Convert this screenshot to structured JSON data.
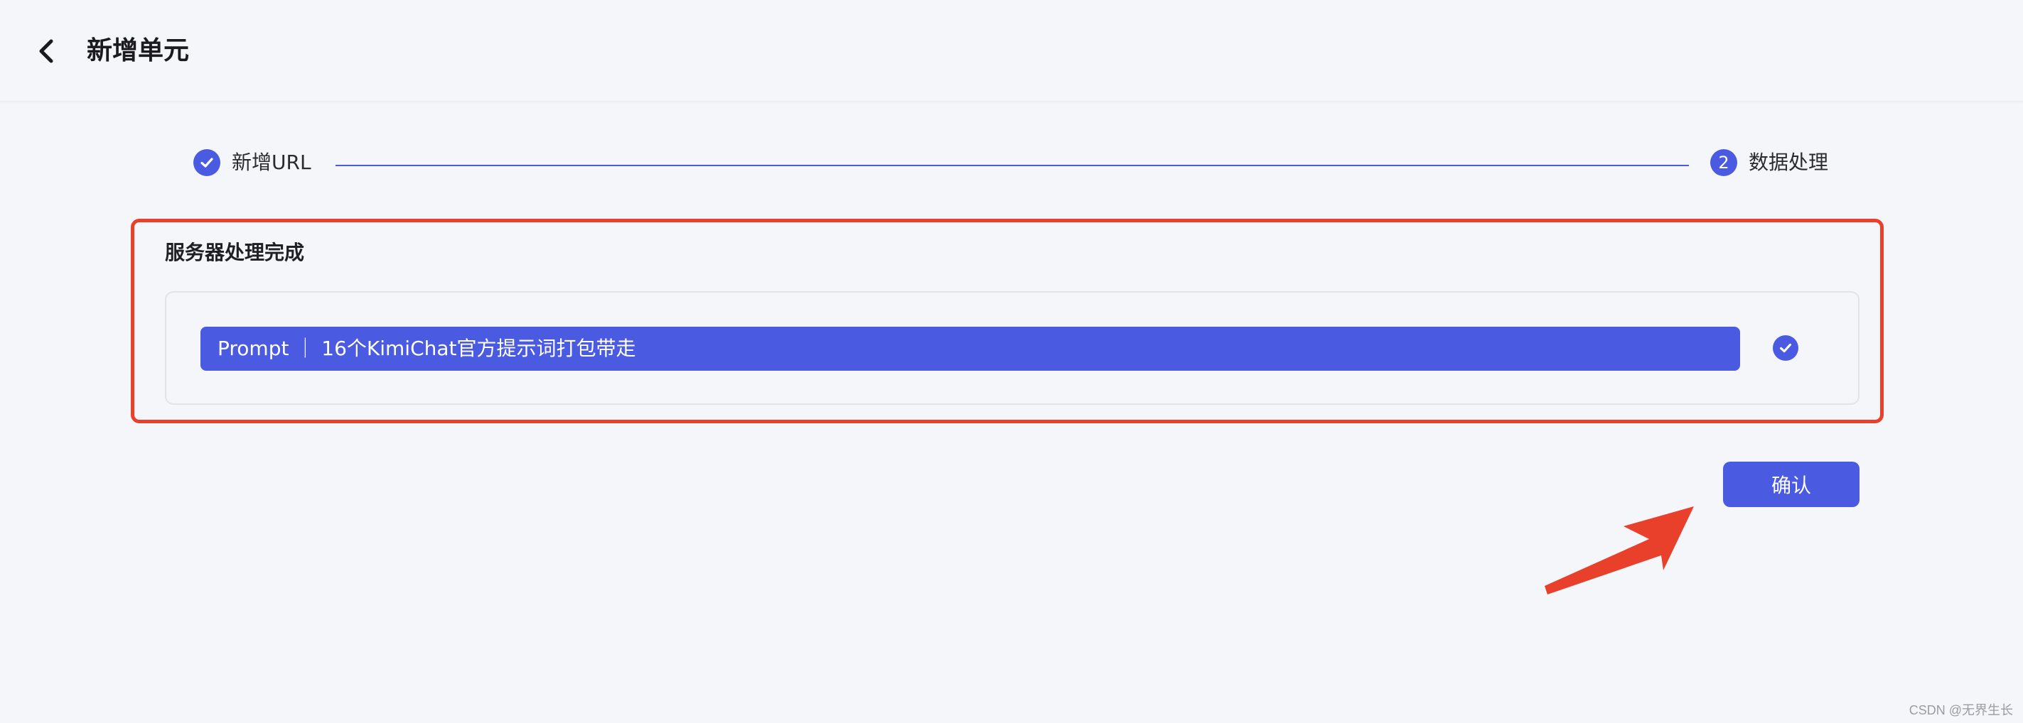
{
  "header": {
    "back_icon": "chevron-left-icon",
    "title": "新增单元"
  },
  "stepper": {
    "steps": [
      {
        "index": "1",
        "label": "新增URL",
        "status": "done",
        "icon": "check-icon"
      },
      {
        "index": "2",
        "label": "数据处理",
        "status": "active"
      }
    ],
    "accent_color": "#4a5ae1"
  },
  "result": {
    "section_title": "服务器处理完成",
    "items": [
      {
        "label": "Prompt ｜ 16个KimiChat官方提示词打包带走",
        "status_icon": "check-circle-icon",
        "progress": 1.0
      }
    ]
  },
  "actions": {
    "confirm_label": "确认"
  },
  "annotations": {
    "highlight_color": "#e8402b",
    "arrow_icon": "arrow-pointer-icon"
  },
  "watermark": "CSDN @无界生长"
}
